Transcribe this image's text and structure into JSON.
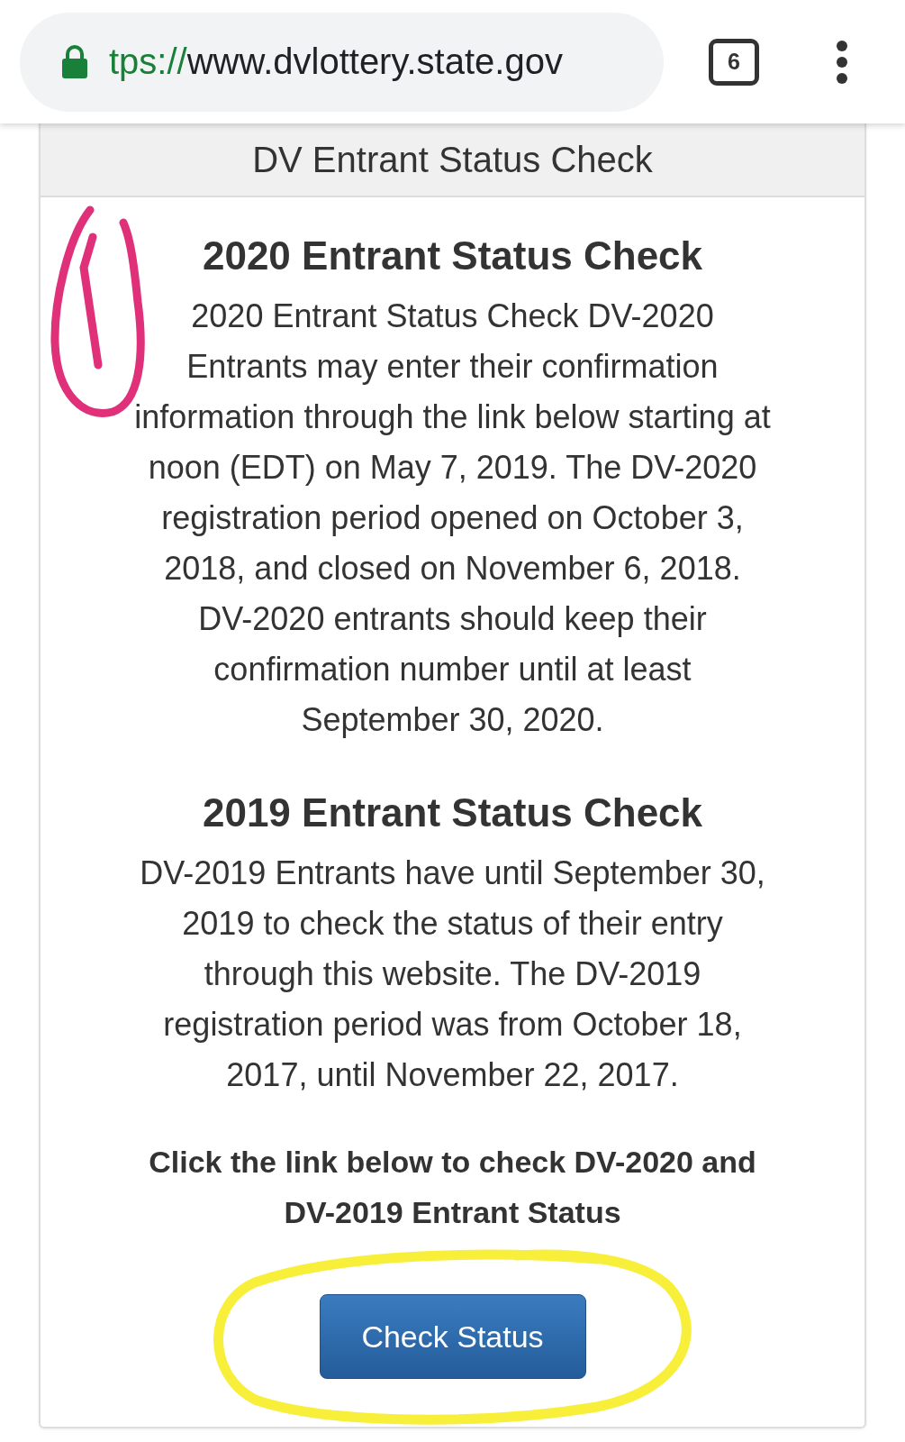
{
  "browser": {
    "url_scheme": "tps://",
    "url_host": "www.dvlottery.state.gov",
    "tab_count": "6"
  },
  "page": {
    "header": "DV Entrant Status Check",
    "sections": [
      {
        "title": "2020 Entrant Status Check",
        "text": "2020 Entrant Status Check DV-2020 Entrants may enter their confirmation information through the link below starting at noon (EDT) on May 7, 2019. The DV-2020 registration period opened on October 3, 2018, and closed on November 6, 2018. DV-2020 entrants should keep their confirmation number until at least September 30, 2020."
      },
      {
        "title": "2019 Entrant Status Check",
        "text": "DV-2019 Entrants have until September 30, 2019 to check the status of their entry through this website. The DV-2019 registration period was from October 18, 2017, until November 22, 2017."
      }
    ],
    "instruction": "Click the link below to check DV-2020 and DV-2019 Entrant Status",
    "button": "Check Status"
  }
}
